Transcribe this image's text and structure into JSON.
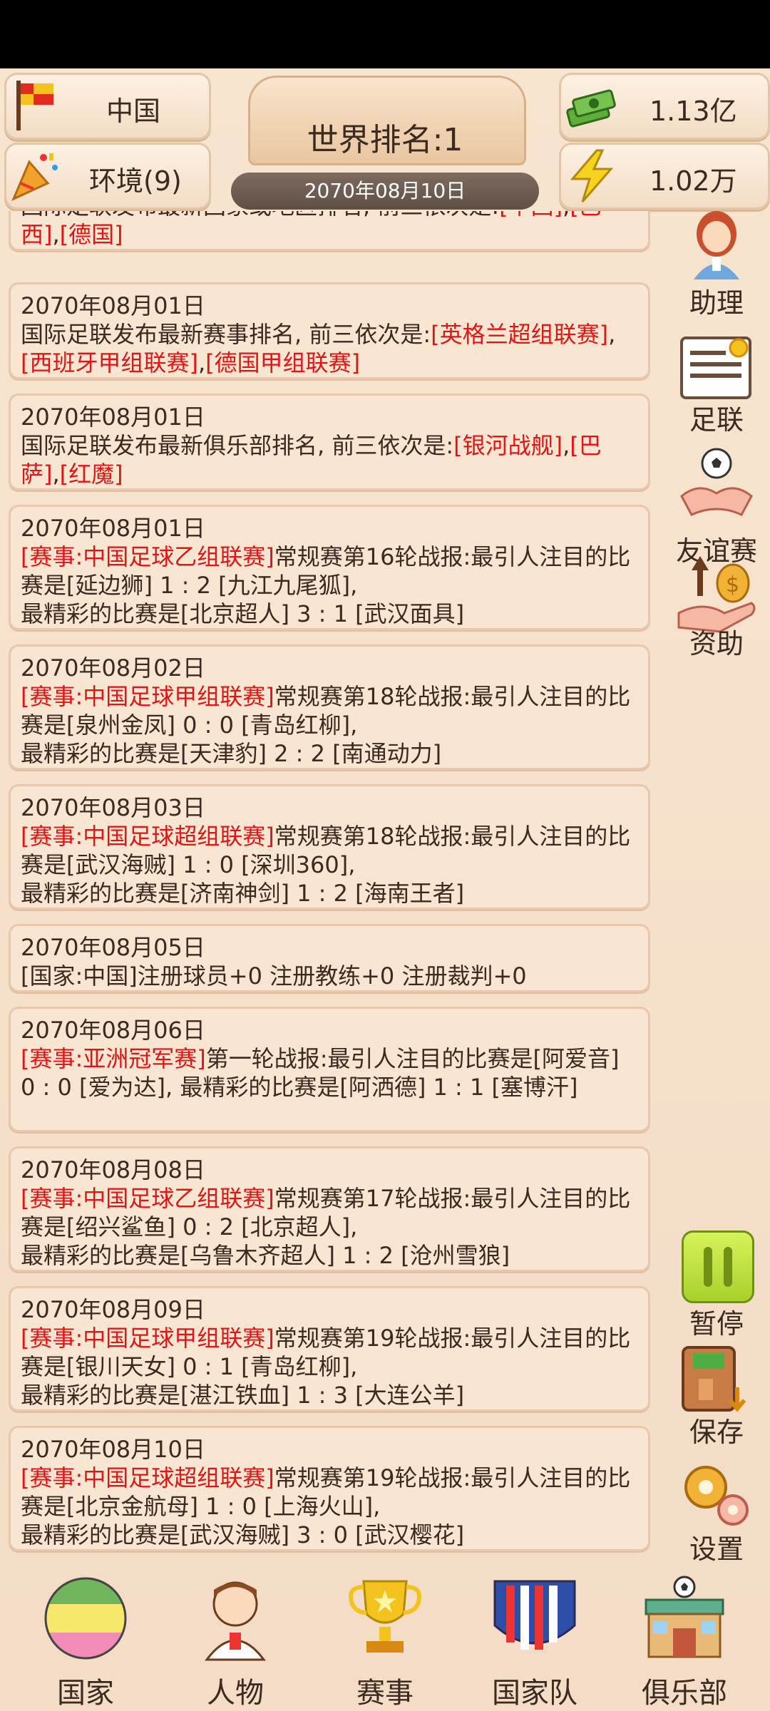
{
  "header": {
    "country": "中国",
    "environment": "环境(9)",
    "world_rank": "世界排名:1",
    "date": "2070年08月10日",
    "money": "1.13亿",
    "energy": "1.02万"
  },
  "news": [
    {
      "date": "",
      "parts": [
        {
          "t": "国际足联发布最新国家或地区排名, 前三依次是:",
          "r": false
        },
        {
          "t": "[中国]",
          "r": true
        },
        {
          "t": ",",
          "r": false
        },
        {
          "t": "[巴西]",
          "r": true
        },
        {
          "t": ",",
          "r": false
        },
        {
          "t": "[德国]",
          "r": true
        }
      ]
    },
    {
      "date": "2070年08月01日",
      "parts": [
        {
          "t": "国际足联发布最新赛事排名, 前三依次是:",
          "r": false
        },
        {
          "t": "[英格兰超组联赛]",
          "r": true
        },
        {
          "t": ",",
          "r": false
        },
        {
          "t": "[西班牙甲组联赛]",
          "r": true
        },
        {
          "t": ",",
          "r": false
        },
        {
          "t": "[德国甲组联赛]",
          "r": true
        }
      ]
    },
    {
      "date": "2070年08月01日",
      "parts": [
        {
          "t": "国际足联发布最新俱乐部排名, 前三依次是:",
          "r": false
        },
        {
          "t": "[银河战舰]",
          "r": true
        },
        {
          "t": ",",
          "r": false
        },
        {
          "t": "[巴萨]",
          "r": true
        },
        {
          "t": ",",
          "r": false
        },
        {
          "t": "[红魔]",
          "r": true
        }
      ]
    },
    {
      "date": "2070年08月01日",
      "parts": [
        {
          "t": "[赛事:中国足球乙组联赛]",
          "r": true
        },
        {
          "t": "常规赛第16轮战报:最引人注目的比赛是[延边狮] 1 : 2 [九江九尾狐],",
          "r": false
        },
        {
          "t": "\n最精彩的比赛是[北京超人] 3 : 1 [武汉面具]",
          "r": false
        }
      ]
    },
    {
      "date": "2070年08月02日",
      "parts": [
        {
          "t": "[赛事:中国足球甲组联赛]",
          "r": true
        },
        {
          "t": "常规赛第18轮战报:最引人注目的比赛是[泉州金凤] 0 : 0 [青岛红柳],",
          "r": false
        },
        {
          "t": "\n最精彩的比赛是[天津豹] 2 : 2 [南通动力]",
          "r": false
        }
      ]
    },
    {
      "date": "2070年08月03日",
      "parts": [
        {
          "t": "[赛事:中国足球超组联赛]",
          "r": true
        },
        {
          "t": "常规赛第18轮战报:最引人注目的比赛是[武汉海贼] 1 : 0 [深圳360],",
          "r": false
        },
        {
          "t": "\n最精彩的比赛是[济南神剑] 1 : 2 [海南王者]",
          "r": false
        }
      ]
    },
    {
      "date": "2070年08月05日",
      "parts": [
        {
          "t": "[国家:中国]注册球员+0 注册教练+0 注册裁判+0",
          "r": false
        }
      ]
    },
    {
      "date": "2070年08月06日",
      "parts": [
        {
          "t": "[赛事:亚洲冠军赛]",
          "r": true
        },
        {
          "t": "第一轮战报:最引人注目的比赛是[阿爱音] 0 : 0 [爱为达], 最精彩的比赛是[阿洒德] 1 : 1 [塞博汗]",
          "r": false
        }
      ]
    },
    {
      "date": "2070年08月08日",
      "parts": [
        {
          "t": "[赛事:中国足球乙组联赛]",
          "r": true
        },
        {
          "t": "常规赛第17轮战报:最引人注目的比赛是[绍兴鲨鱼] 0 : 2 [北京超人],",
          "r": false
        },
        {
          "t": "\n最精彩的比赛是[乌鲁木齐超人] 1 : 2 [沧州雪狼]",
          "r": false
        }
      ]
    },
    {
      "date": "2070年08月09日",
      "parts": [
        {
          "t": "[赛事:中国足球甲组联赛]",
          "r": true
        },
        {
          "t": "常规赛第19轮战报:最引人注目的比赛是[银川天女] 0 : 1 [青岛红柳],",
          "r": false
        },
        {
          "t": "\n最精彩的比赛是[湛江铁血] 1 : 3 [大连公羊]",
          "r": false
        }
      ]
    },
    {
      "date": "2070年08月10日",
      "parts": [
        {
          "t": "[赛事:中国足球超组联赛]",
          "r": true
        },
        {
          "t": "常规赛第19轮战报:最引人注目的比赛是[北京金航母] 1 : 0 [上海火山],",
          "r": false
        },
        {
          "t": "\n最精彩的比赛是[武汉海贼] 3 : 0 [武汉樱花]",
          "r": false
        }
      ]
    }
  ],
  "side": {
    "assistant": "助理",
    "fifa": "足联",
    "friendly": "友谊赛",
    "sponsor": "资助",
    "pause": "暂停",
    "save": "保存",
    "settings": "设置"
  },
  "nav": {
    "country": "国家",
    "people": "人物",
    "events": "赛事",
    "national_team": "国家队",
    "club": "俱乐部"
  },
  "colors": {
    "highlight": "#e01515",
    "text": "#3a2a20",
    "background": "#f6e6d4"
  }
}
